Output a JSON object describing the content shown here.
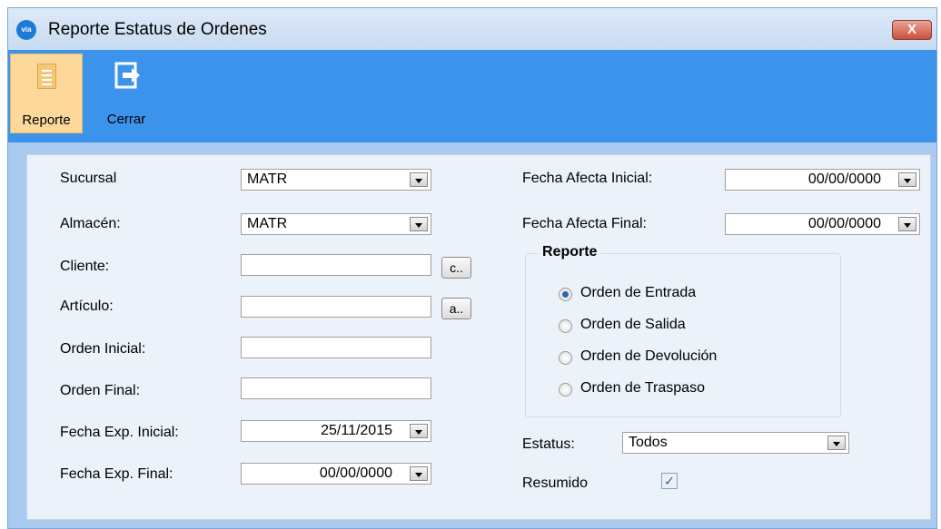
{
  "window": {
    "title": "Reporte  Estatus de Ordenes",
    "logo_text": "via",
    "close_label": "X"
  },
  "toolbar": {
    "report_label": "Reporte",
    "close_label": "Cerrar"
  },
  "form": {
    "sucursal": {
      "label": "Sucursal",
      "value": "MATR"
    },
    "almacen": {
      "label": "Almacén:",
      "value": "MATR"
    },
    "cliente": {
      "label": "Cliente:",
      "value": "",
      "button": "c.."
    },
    "articulo": {
      "label": "Artículo:",
      "value": "",
      "button": "a.."
    },
    "orden_inicial": {
      "label": "Orden Inicial:",
      "value": ""
    },
    "orden_final": {
      "label": "Orden Final:",
      "value": ""
    },
    "fecha_exp_inicial": {
      "label": "Fecha Exp. Inicial:",
      "value": "25/11/2015"
    },
    "fecha_exp_final": {
      "label": "Fecha Exp. Final:",
      "value": "00/00/0000"
    },
    "fecha_afecta_inicial": {
      "label": "Fecha Afecta Inicial:",
      "value": "00/00/0000"
    },
    "fecha_afecta_final": {
      "label": "Fecha Afecta Final:",
      "value": "00/00/0000"
    },
    "reporte_group": {
      "title": "Reporte",
      "options": [
        "Orden de Entrada",
        "Orden de Salida",
        "Orden de Devolución",
        "Orden de Traspaso"
      ],
      "selected": "Orden de Entrada"
    },
    "estatus": {
      "label": "Estatus:",
      "value": "Todos"
    },
    "resumido": {
      "label": "Resumido",
      "checked": true,
      "mark": "✓"
    }
  },
  "colors": {
    "ribbon": "#3c93ec",
    "active_button": "#fcd99b",
    "form_bg": "#ebf2fa",
    "window_bg": "#a9cbf0"
  }
}
